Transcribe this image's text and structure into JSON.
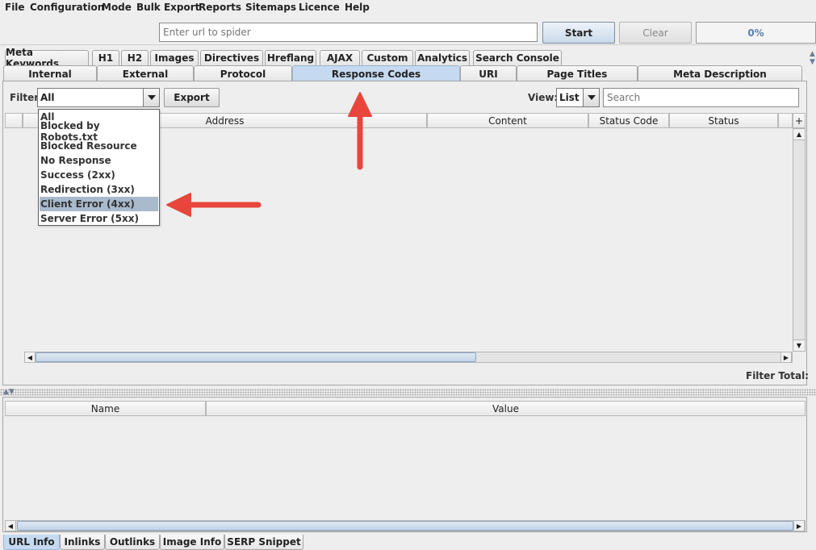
{
  "menubar": {
    "items": [
      "File",
      "Configuration",
      "Mode",
      "Bulk Export",
      "Reports",
      "Sitemaps",
      "Licence",
      "Help"
    ]
  },
  "toolbar": {
    "url_placeholder": "Enter url to spider",
    "start_label": "Start",
    "clear_label": "Clear",
    "progress_text": "0%"
  },
  "tabs": {
    "row1": [
      "Meta Keywords",
      "H1",
      "H2",
      "Images",
      "Directives",
      "Hreflang",
      "AJAX",
      "Custom",
      "Analytics",
      "Search Console"
    ],
    "row2": [
      "Internal",
      "External",
      "Protocol",
      "Response Codes",
      "URI",
      "Page Titles",
      "Meta Description"
    ],
    "active": "Response Codes"
  },
  "filterbar": {
    "filter_label": "Filter:",
    "filter_value": "All",
    "export_label": "Export",
    "view_label": "View:",
    "view_value": "List",
    "search_placeholder": "Search"
  },
  "grid": {
    "columns": [
      "Address",
      "Content",
      "Status Code",
      "Status"
    ],
    "add_column": "+",
    "filter_total_label": "Filter Total:"
  },
  "dropdown": {
    "options": [
      "All",
      "Blocked by Robots.txt",
      "Blocked Resource",
      "No Response",
      "Success (2xx)",
      "Redirection (3xx)",
      "Client Error (4xx)",
      "Server Error (5xx)"
    ],
    "highlighted": "Client Error (4xx)"
  },
  "details": {
    "columns": [
      "Name",
      "Value"
    ]
  },
  "bottom_tabs": {
    "items": [
      "URL Info",
      "Inlinks",
      "Outlinks",
      "Image Info",
      "SERP Snippet"
    ],
    "active": "URL Info"
  },
  "colors": {
    "active_tab": "#c5daf0",
    "annotation_arrow": "#e8463c",
    "highlight": "#a9bacd",
    "progress_text": "#5b7fae"
  }
}
